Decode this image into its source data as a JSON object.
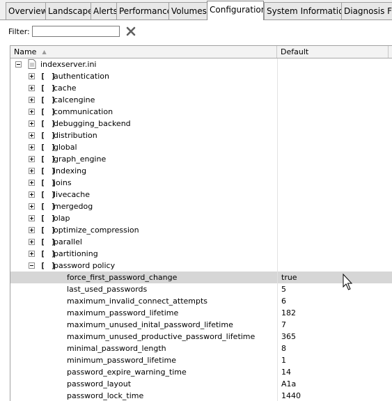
{
  "tabs": [
    "Overview",
    "Landscape",
    "Alerts",
    "Performance",
    "Volumes",
    "Configuration",
    "System Information",
    "Diagnosis Files"
  ],
  "active_tab": "Configuration",
  "filter": {
    "label": "Filter:",
    "value": "",
    "clear_icon": "clear-x-icon"
  },
  "table": {
    "columns": {
      "name": "Name",
      "default": "Default"
    },
    "root": "indexserver.ini",
    "sections": [
      "authentication",
      "cache",
      "calcengine",
      "communication",
      "debugging_backend",
      "distribution",
      "global",
      "graph_engine",
      "indexing",
      "joins",
      "livecache",
      "mergedog",
      "olap",
      "optimize_compression",
      "parallel",
      "partitioning"
    ],
    "expanded_section": "password policy",
    "params": [
      {
        "name": "force_first_password_change",
        "value": "true"
      },
      {
        "name": "last_used_passwords",
        "value": "5"
      },
      {
        "name": "maximum_invalid_connect_attempts",
        "value": "6"
      },
      {
        "name": "maximum_password_lifetime",
        "value": "182"
      },
      {
        "name": "maximum_unused_inital_password_lifetime",
        "value": "7"
      },
      {
        "name": "maximum_unused_productive_password_lifetime",
        "value": "365"
      },
      {
        "name": "minimal_password_length",
        "value": "8"
      },
      {
        "name": "minimum_password_lifetime",
        "value": "1"
      },
      {
        "name": "password_expire_warning_time",
        "value": "14"
      },
      {
        "name": "password_layout",
        "value": "A1a"
      },
      {
        "name": "password_lock_time",
        "value": "1440"
      }
    ],
    "selected_param": "force_first_password_change"
  },
  "colors": {
    "selection": "#d6d6d6",
    "header_bg": "#f3f3f3",
    "tabbar_bg": "#f0f0f0",
    "clear_icon": "#5f5f5f"
  }
}
